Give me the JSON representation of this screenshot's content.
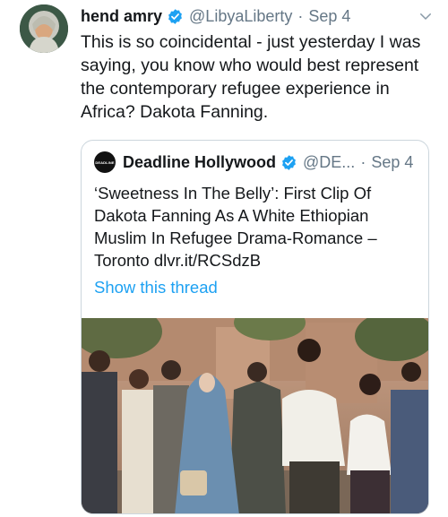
{
  "tweet": {
    "author_name": "hend amry",
    "author_handle": "@LibyaLiberty",
    "separator": "·",
    "date": "Sep 4",
    "text": "This is so coincidental - just yesterday I was\nsaying, you know who would best represent\nthe contemporary refugee experience in\nAfrica? Dakota Fanning.",
    "verified": true,
    "avatar_icon": "user-avatar-photo",
    "menu_icon": "chevron-down-icon"
  },
  "quoted": {
    "logo_text": "DEADLINE",
    "author_name": "Deadline Hollywood",
    "author_handle": "@DE...",
    "separator": "·",
    "date": "Sep 4",
    "verified": true,
    "text": "‘Sweetness In The Belly’: First Clip Of\nDakota Fanning As A White Ethiopian\nMuslim In Refugee Drama-Romance –\nToronto dlvr.it/RCSdzB",
    "show_thread": "Show this thread",
    "image_icon": "movie-still-photo"
  },
  "colors": {
    "text": "#14171a",
    "muted": "#657786",
    "link": "#1da1f2",
    "verified": "#1da1f2",
    "border": "#ccd6dd"
  }
}
